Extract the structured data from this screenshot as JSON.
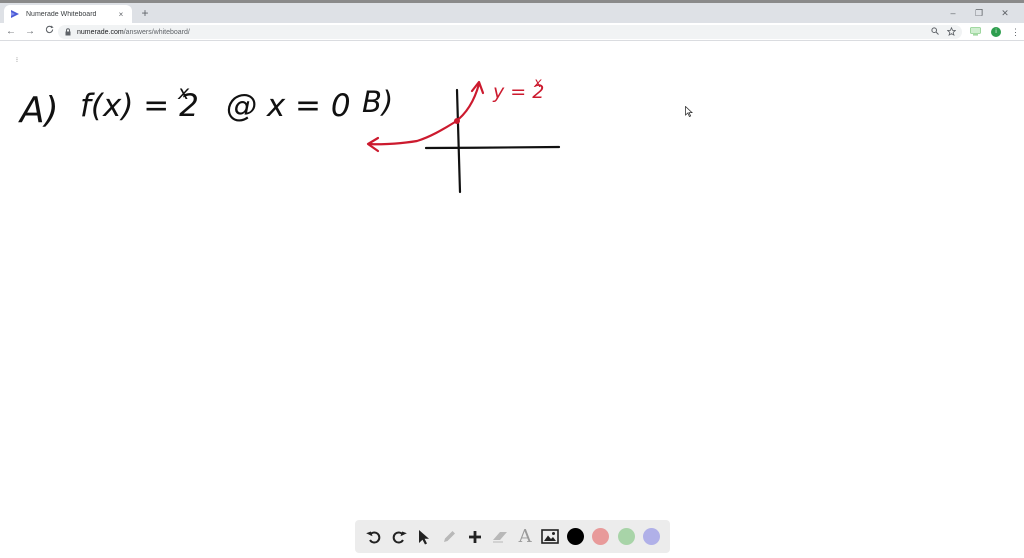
{
  "browser": {
    "tab_title": "Numerade Whiteboard",
    "tab_close": "×",
    "new_tab": "+",
    "window_controls": {
      "minimize": "–",
      "restore": "❐",
      "close": "✕"
    },
    "nav": {
      "back": "←",
      "forward": "→",
      "reload": "C"
    },
    "url_host": "numerade.com",
    "url_path": "/answers/whiteboard/",
    "profile_initial": "i",
    "menu": "⋮"
  },
  "whiteboard": {
    "menu_glyph": "⁝",
    "handwriting": {
      "part_a_label": "A)",
      "part_a_function": "f(x) = 2",
      "part_a_exponent": "x",
      "part_a_condition": "@ x = 0",
      "part_b_label": "B)",
      "curve_label": "y = 2",
      "curve_exponent": "x"
    },
    "colors": {
      "ink": "#111111",
      "red_ink": "#cc1a2e"
    }
  },
  "draw_toolbar": {
    "tools": [
      "undo-icon",
      "redo-icon",
      "select-icon",
      "pen-icon",
      "add-icon",
      "eraser-icon",
      "text-icon",
      "image-icon"
    ],
    "text_tool_glyph": "A",
    "swatches": [
      "#000000",
      "#e89a9a",
      "#a8d4a8",
      "#b0b0e8"
    ]
  }
}
